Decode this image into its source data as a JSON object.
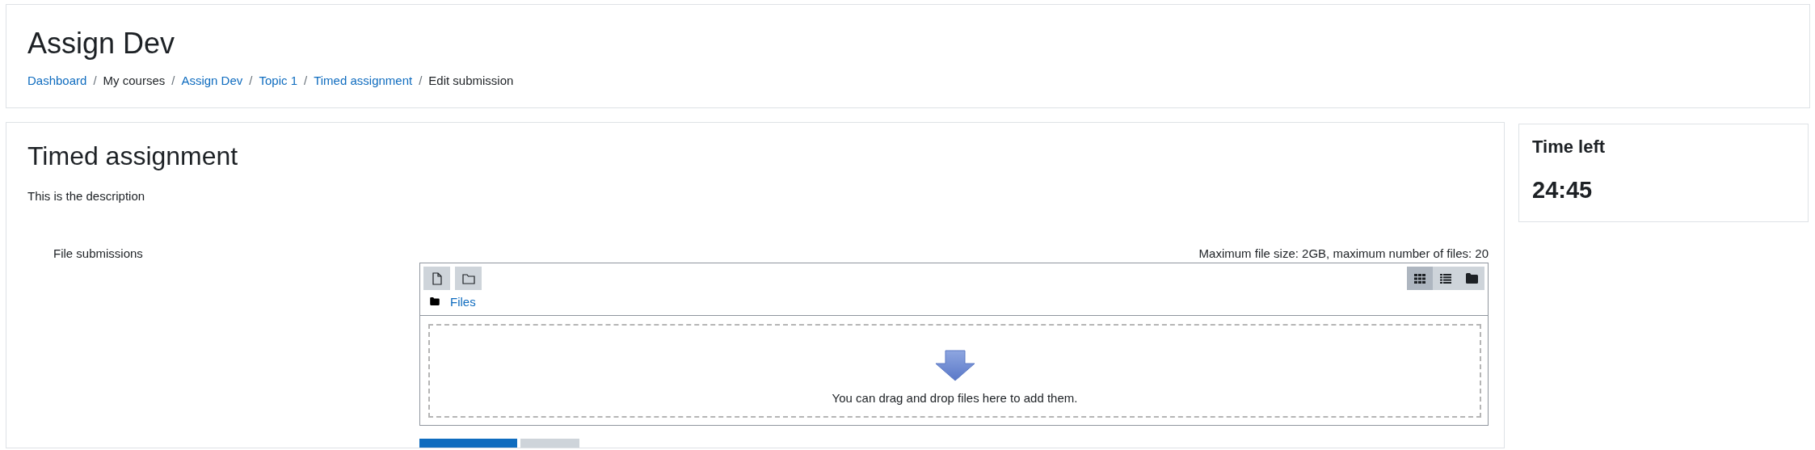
{
  "header": {
    "title": "Assign Dev",
    "separator": "/",
    "breadcrumb": [
      {
        "label": "Dashboard",
        "link": true
      },
      {
        "label": "My courses",
        "link": false
      },
      {
        "label": "Assign Dev",
        "link": true
      },
      {
        "label": "Topic 1",
        "link": true
      },
      {
        "label": "Timed assignment",
        "link": true
      },
      {
        "label": "Edit submission",
        "link": false
      }
    ]
  },
  "assignment": {
    "title": "Timed assignment",
    "description": "This is the description",
    "field_label": "File submissions",
    "limits": "Maximum file size: 2GB, maximum number of files: 20",
    "file_manager": {
      "actions": [
        {
          "kind": "add-file"
        },
        {
          "kind": "create-folder"
        }
      ],
      "views": [
        {
          "kind": "grid",
          "selected": true
        },
        {
          "kind": "list",
          "selected": false
        },
        {
          "kind": "tree",
          "selected": false
        }
      ],
      "path": "Files",
      "drop_hint": "You can drag and drop files here to add them."
    },
    "buttons": [
      {
        "kind": "primary"
      },
      {
        "kind": "secondary"
      }
    ]
  },
  "timer": {
    "title": "Time left",
    "value": "24:45"
  }
}
